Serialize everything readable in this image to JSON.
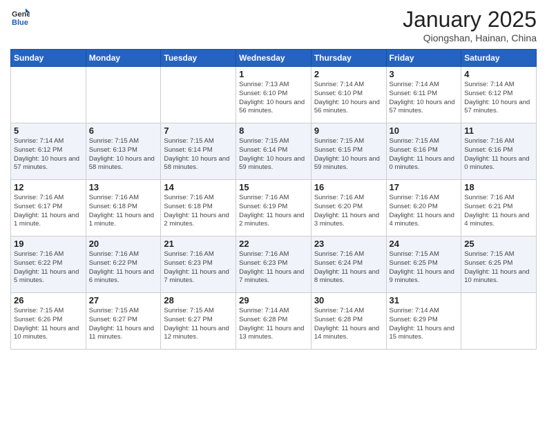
{
  "logo": {
    "text_general": "General",
    "text_blue": "Blue"
  },
  "header": {
    "month_title": "January 2025",
    "location": "Qiongshan, Hainan, China"
  },
  "weekdays": [
    "Sunday",
    "Monday",
    "Tuesday",
    "Wednesday",
    "Thursday",
    "Friday",
    "Saturday"
  ],
  "weeks": [
    [
      {
        "day": "",
        "sunrise": "",
        "sunset": "",
        "daylight": ""
      },
      {
        "day": "",
        "sunrise": "",
        "sunset": "",
        "daylight": ""
      },
      {
        "day": "",
        "sunrise": "",
        "sunset": "",
        "daylight": ""
      },
      {
        "day": "1",
        "sunrise": "Sunrise: 7:13 AM",
        "sunset": "Sunset: 6:10 PM",
        "daylight": "Daylight: 10 hours and 56 minutes."
      },
      {
        "day": "2",
        "sunrise": "Sunrise: 7:14 AM",
        "sunset": "Sunset: 6:10 PM",
        "daylight": "Daylight: 10 hours and 56 minutes."
      },
      {
        "day": "3",
        "sunrise": "Sunrise: 7:14 AM",
        "sunset": "Sunset: 6:11 PM",
        "daylight": "Daylight: 10 hours and 57 minutes."
      },
      {
        "day": "4",
        "sunrise": "Sunrise: 7:14 AM",
        "sunset": "Sunset: 6:12 PM",
        "daylight": "Daylight: 10 hours and 57 minutes."
      }
    ],
    [
      {
        "day": "5",
        "sunrise": "Sunrise: 7:14 AM",
        "sunset": "Sunset: 6:12 PM",
        "daylight": "Daylight: 10 hours and 57 minutes."
      },
      {
        "day": "6",
        "sunrise": "Sunrise: 7:15 AM",
        "sunset": "Sunset: 6:13 PM",
        "daylight": "Daylight: 10 hours and 58 minutes."
      },
      {
        "day": "7",
        "sunrise": "Sunrise: 7:15 AM",
        "sunset": "Sunset: 6:14 PM",
        "daylight": "Daylight: 10 hours and 58 minutes."
      },
      {
        "day": "8",
        "sunrise": "Sunrise: 7:15 AM",
        "sunset": "Sunset: 6:14 PM",
        "daylight": "Daylight: 10 hours and 59 minutes."
      },
      {
        "day": "9",
        "sunrise": "Sunrise: 7:15 AM",
        "sunset": "Sunset: 6:15 PM",
        "daylight": "Daylight: 10 hours and 59 minutes."
      },
      {
        "day": "10",
        "sunrise": "Sunrise: 7:15 AM",
        "sunset": "Sunset: 6:16 PM",
        "daylight": "Daylight: 11 hours and 0 minutes."
      },
      {
        "day": "11",
        "sunrise": "Sunrise: 7:16 AM",
        "sunset": "Sunset: 6:16 PM",
        "daylight": "Daylight: 11 hours and 0 minutes."
      }
    ],
    [
      {
        "day": "12",
        "sunrise": "Sunrise: 7:16 AM",
        "sunset": "Sunset: 6:17 PM",
        "daylight": "Daylight: 11 hours and 1 minute."
      },
      {
        "day": "13",
        "sunrise": "Sunrise: 7:16 AM",
        "sunset": "Sunset: 6:18 PM",
        "daylight": "Daylight: 11 hours and 1 minute."
      },
      {
        "day": "14",
        "sunrise": "Sunrise: 7:16 AM",
        "sunset": "Sunset: 6:18 PM",
        "daylight": "Daylight: 11 hours and 2 minutes."
      },
      {
        "day": "15",
        "sunrise": "Sunrise: 7:16 AM",
        "sunset": "Sunset: 6:19 PM",
        "daylight": "Daylight: 11 hours and 2 minutes."
      },
      {
        "day": "16",
        "sunrise": "Sunrise: 7:16 AM",
        "sunset": "Sunset: 6:20 PM",
        "daylight": "Daylight: 11 hours and 3 minutes."
      },
      {
        "day": "17",
        "sunrise": "Sunrise: 7:16 AM",
        "sunset": "Sunset: 6:20 PM",
        "daylight": "Daylight: 11 hours and 4 minutes."
      },
      {
        "day": "18",
        "sunrise": "Sunrise: 7:16 AM",
        "sunset": "Sunset: 6:21 PM",
        "daylight": "Daylight: 11 hours and 4 minutes."
      }
    ],
    [
      {
        "day": "19",
        "sunrise": "Sunrise: 7:16 AM",
        "sunset": "Sunset: 6:22 PM",
        "daylight": "Daylight: 11 hours and 5 minutes."
      },
      {
        "day": "20",
        "sunrise": "Sunrise: 7:16 AM",
        "sunset": "Sunset: 6:22 PM",
        "daylight": "Daylight: 11 hours and 6 minutes."
      },
      {
        "day": "21",
        "sunrise": "Sunrise: 7:16 AM",
        "sunset": "Sunset: 6:23 PM",
        "daylight": "Daylight: 11 hours and 7 minutes."
      },
      {
        "day": "22",
        "sunrise": "Sunrise: 7:16 AM",
        "sunset": "Sunset: 6:23 PM",
        "daylight": "Daylight: 11 hours and 7 minutes."
      },
      {
        "day": "23",
        "sunrise": "Sunrise: 7:16 AM",
        "sunset": "Sunset: 6:24 PM",
        "daylight": "Daylight: 11 hours and 8 minutes."
      },
      {
        "day": "24",
        "sunrise": "Sunrise: 7:15 AM",
        "sunset": "Sunset: 6:25 PM",
        "daylight": "Daylight: 11 hours and 9 minutes."
      },
      {
        "day": "25",
        "sunrise": "Sunrise: 7:15 AM",
        "sunset": "Sunset: 6:25 PM",
        "daylight": "Daylight: 11 hours and 10 minutes."
      }
    ],
    [
      {
        "day": "26",
        "sunrise": "Sunrise: 7:15 AM",
        "sunset": "Sunset: 6:26 PM",
        "daylight": "Daylight: 11 hours and 10 minutes."
      },
      {
        "day": "27",
        "sunrise": "Sunrise: 7:15 AM",
        "sunset": "Sunset: 6:27 PM",
        "daylight": "Daylight: 11 hours and 11 minutes."
      },
      {
        "day": "28",
        "sunrise": "Sunrise: 7:15 AM",
        "sunset": "Sunset: 6:27 PM",
        "daylight": "Daylight: 11 hours and 12 minutes."
      },
      {
        "day": "29",
        "sunrise": "Sunrise: 7:14 AM",
        "sunset": "Sunset: 6:28 PM",
        "daylight": "Daylight: 11 hours and 13 minutes."
      },
      {
        "day": "30",
        "sunrise": "Sunrise: 7:14 AM",
        "sunset": "Sunset: 6:28 PM",
        "daylight": "Daylight: 11 hours and 14 minutes."
      },
      {
        "day": "31",
        "sunrise": "Sunrise: 7:14 AM",
        "sunset": "Sunset: 6:29 PM",
        "daylight": "Daylight: 11 hours and 15 minutes."
      },
      {
        "day": "",
        "sunrise": "",
        "sunset": "",
        "daylight": ""
      }
    ]
  ]
}
